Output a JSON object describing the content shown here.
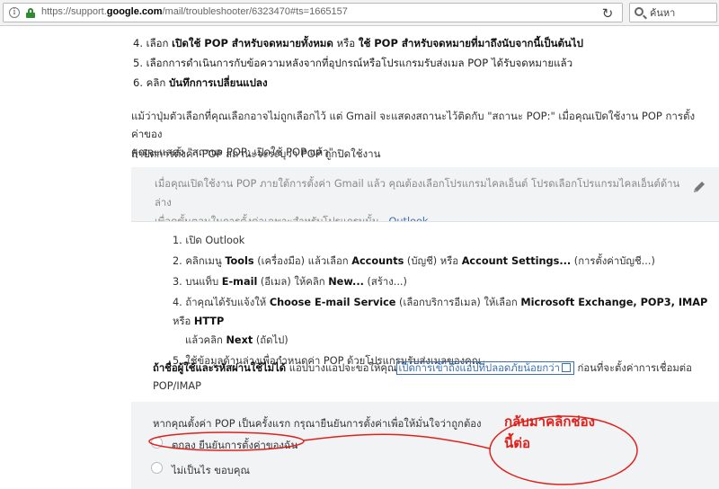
{
  "browser": {
    "url_prefix": "https://support.",
    "url_host": "google.com",
    "url_path": "/mail/troubleshooter/6323470#ts=1665157",
    "search_placeholder": "ค้นหา",
    "reload_icon": "reload-icon"
  },
  "steps_top": [
    {
      "num": "4.",
      "pre": "เลือก ",
      "bold1": "เปิดใช้ POP สำหรับจดหมายทั้งหมด",
      "mid": " หรือ ",
      "bold2": "ใช้ POP สำหรับจดหมายที่มาถึงนับจากนี้เป็นต้นไป"
    },
    {
      "num": "5.",
      "text": "เลือกการดำเนินการกับข้อความหลังจากที่อุปกรณ์หรือโปรแกรมรับส่งเมล POP ได้รับจดหมายแล้ว"
    },
    {
      "num": "6.",
      "pre": "คลิก ",
      "bold1": "บันทึกการเปลี่ยนแปลง"
    }
  ],
  "para1_line1": "แม้ว่าปุ่มตัวเลือกที่คุณเลือกอาจไม่ถูกเลือกไว้ แต่ Gmail จะแสดงสถานะไว้ติดกับ \"สถานะ POP:\" เมื่อคุณเปิดใช้งาน POP การตั้งค่าของ",
  "para1_line2": "คุณจะแสดง \"สถานะ POP: เปิดใช้ POP แล้ว\"",
  "para2": "ถ้าปิดการตั้งค่า POP สถานะจะระบุว่า POP ถูกปิดใช้งาน",
  "box": {
    "intro_line1": "เมื่อคุณเปิดใช้งาน POP ภายใต้การตั้งค่า Gmail แล้ว คุณต้องเลือกโปรแกรมไคลเอ็นต์ โปรดเลือกโปรแกรมไคลเอ็นต์ด้านล่าง",
    "intro_line2": "เพื่อดูขั้นตอนในการตั้งค่าเฉพาะสำหรับโปรแกรมนั้น",
    "selected_client": "Outlook",
    "edit_icon": "pencil-icon",
    "steps": [
      {
        "num": "1.",
        "text": "เปิด Outlook"
      },
      {
        "num": "2.",
        "pre": "คลิกเมนู ",
        "b1": "Tools",
        "t1": " (เครื่องมือ) แล้วเลือก ",
        "b2": "Accounts",
        "t2": " (บัญชี) หรือ ",
        "b3": "Account Settings...",
        "t3": " (การตั้งค่าบัญชี...)"
      },
      {
        "num": "3.",
        "pre": "บนแท็บ ",
        "b1": "E-mail",
        "t1": " (อีเมล) ให้คลิก ",
        "b2": "New...",
        "t2": " (สร้าง...)"
      },
      {
        "num": "4.",
        "pre": "ถ้าคุณได้รับแจ้งให้ ",
        "b1": "Choose E-mail Service",
        "t1": " (เลือกบริการอีเมล) ให้เลือก ",
        "b2": "Microsoft Exchange, POP3, IMAP",
        "t2": " หรือ ",
        "b3": "HTTP",
        "line2_pre": "แล้วคลิก ",
        "line2_b": "Next",
        "line2_post": " (ถัดไป)"
      },
      {
        "num": "5.",
        "text": "ใช้ข้อมูลด้านล่างเพื่อกำหนดค่า POP ด้วยโปรแกรมรับส่งเมลของคุณ"
      }
    ],
    "warn_bold": "ถ้าชื่อผู้ใช้และรหัสผ่านใช้ไม่ได้",
    "warn_pre": " แอปบางแอปจะขอให้คุณ",
    "warn_link": "เปิดการเข้าถึงแอปที่ปลอดภัยน้อยกว่า",
    "warn_post": " ก่อนที่จะตั้งค่าการเชื่อมต่อ",
    "warn_line2": "POP/IMAP",
    "question": "หากคุณตั้งค่า POP เป็นครั้งแรก กรุณายืนยันการตั้งค่าเพื่อให้มั่นใจว่าถูกต้อง",
    "options": [
      "ตกลง ยืนยันการตั้งค่าของฉัน",
      "ไม่เป็นไร ขอบคุณ"
    ]
  },
  "annotation": {
    "line1": "กลับมาคลิกช่อง",
    "line2": "นี้ต่อ",
    "color": "#e0201a"
  }
}
